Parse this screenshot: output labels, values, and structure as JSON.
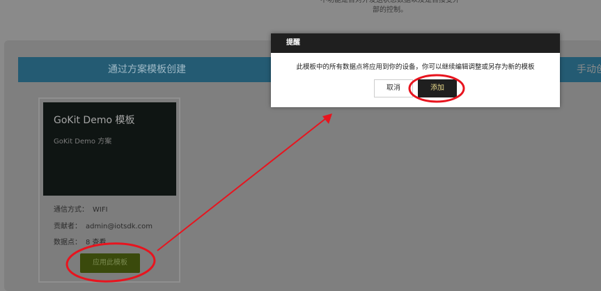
{
  "top_note": {
    "line1": "不功能是否对外发送状态数据以及是否接受外",
    "line2": "部的控制。"
  },
  "tabs": {
    "template_label": "通过方案模板创建",
    "manual_label": "手动创"
  },
  "card": {
    "title": "GoKit Demo 模板",
    "subtitle": "GoKit Demo 方案",
    "comm_label": "通信方式：",
    "comm_value": "WIFI",
    "contributor_label": "贡献者：",
    "contributor_value": "admin@iotsdk.com",
    "datapoints_label": "数据点：",
    "datapoints_value": "8 查看",
    "apply_button": "应用此模板"
  },
  "dialog": {
    "title": "提醒",
    "message": "此模板中的所有数据点将应用到你的设备，你可以继续编辑调整或另存为新的模板",
    "cancel_button": "取消",
    "add_button": "添加"
  },
  "colors": {
    "annotation": "#e8141e",
    "tabbar": "#245b73",
    "apply_button": "#3a4a0c",
    "dialog_header": "#1f1f1f"
  }
}
